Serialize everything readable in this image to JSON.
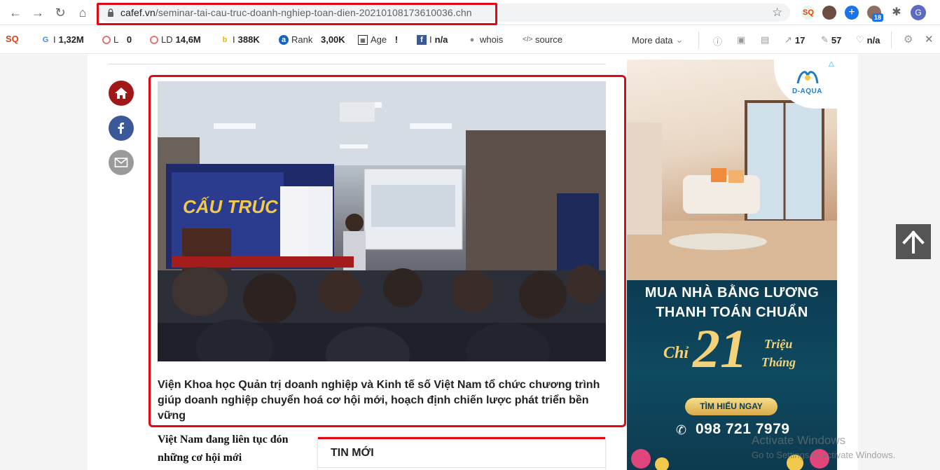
{
  "browser": {
    "url_host": "cafef.vn",
    "url_path": "/seminar-tai-cau-truc-doanh-nghiep-toan-dien-20210108173610036.chn",
    "extension_badge": "18",
    "profile_initial": "G"
  },
  "seo_toolbar": {
    "google_label": "I",
    "google_value": "1,32M",
    "l_label": "L",
    "l_value": "0",
    "ld_label": "LD",
    "ld_value": "14,6M",
    "bing_label": "I",
    "bing_value": "388K",
    "rank_label": "Rank",
    "rank_value": "3,00K",
    "age_label": "Age",
    "age_value": "!",
    "fb_label": "I",
    "fb_value": "n/a",
    "whois_label": "whois",
    "source_label": "source",
    "more_data_label": "More data",
    "external_links_value": "17",
    "internal_links_value": "57",
    "social_value": "n/a"
  },
  "article": {
    "caption": "Viện Khoa học Quản trị doanh nghiệp và Kinh tế số Việt Nam tổ chức chương trình giúp doanh nghiệp chuyển hoá cơ hội mới, hoạch định chiến lược phát triển bền vững",
    "lead_text": "Việt Nam đang liên tục đón những cơ hội mới",
    "latest_news_title": "TIN MỚI",
    "photo_banner_text": "CẤU TRÚC"
  },
  "ad": {
    "logo_text": "D-AQUA",
    "line1": "MUA NHÀ BẰNG LƯƠNG",
    "line2": "THANH TOÁN CHUẨN",
    "chi": "Chỉ",
    "number": "21",
    "trieu": "Triệu",
    "thang": "Tháng",
    "cta": "TÌM HIỂU NGAY",
    "phone": "098 721 7979"
  },
  "watermark": {
    "line1": "Activate Windows",
    "line2": "Go to Settings to activate Windows."
  },
  "colors": {
    "highlight_red": "#e30613",
    "home_button": "#a01818",
    "facebook_button": "#3b5998",
    "mail_button": "#9a9a9a"
  }
}
